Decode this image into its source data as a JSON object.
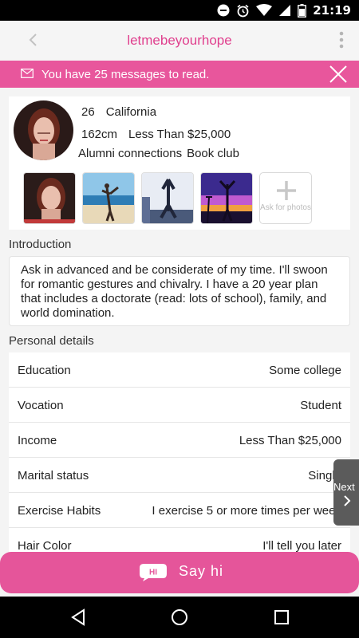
{
  "status_bar": {
    "time": "21:19",
    "icons": [
      "minus-circle-icon",
      "alarm-icon",
      "wifi-icon",
      "signal-icon",
      "battery-icon"
    ]
  },
  "header": {
    "title": "letmebeyourhope",
    "back_icon": "chevron-left-icon",
    "menu_icon": "more-vert-icon"
  },
  "message_banner": {
    "text": "You have 25 messages to read.",
    "icon": "mail-icon",
    "close_icon": "close-icon"
  },
  "profile": {
    "age": "26",
    "location": "California",
    "height": "162cm",
    "income": "Less Than $25,000",
    "tags": [
      "Alumni connections",
      "Book club"
    ],
    "photos_add_label": "Ask for photos"
  },
  "introduction": {
    "title": "Introduction",
    "text": "Ask in advanced and be considerate of my time. I'll swoon for romantic gestures and chivalry. I have a 20 year plan that includes a doctorate (read: lots of school), family, and world domination."
  },
  "personal_details": {
    "title": "Personal details",
    "rows": [
      {
        "label": "Education",
        "value": "Some college"
      },
      {
        "label": "Vocation",
        "value": "Student"
      },
      {
        "label": "Income",
        "value": "Less Than $25,000"
      },
      {
        "label": "Marital status",
        "value": "Single"
      },
      {
        "label": "Exercise Habits",
        "value": "I exercise 5 or more times per week"
      },
      {
        "label": "Hair Color",
        "value": "I'll tell you later"
      }
    ]
  },
  "next_button": {
    "label": "Next"
  },
  "say_hi": {
    "label": "Say hi",
    "bubble_text": "HI"
  },
  "colors": {
    "accent": "#e5559a",
    "title_pink": "#e0408e"
  }
}
